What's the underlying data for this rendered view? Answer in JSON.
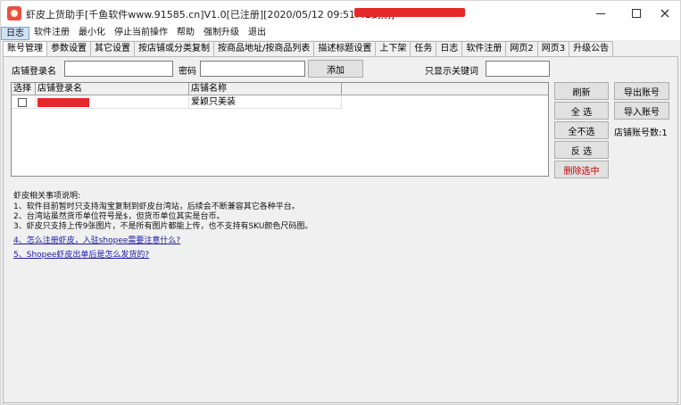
{
  "window": {
    "title": "虾皮上货助手[千鱼软件www.91585.cn]V1.0[已注册][2020/05/12 09:51:41到期]",
    "controls": {
      "minimize": "minimize",
      "maximize": "maximize",
      "close": "×"
    }
  },
  "menubar": {
    "items": [
      "日志",
      "软件注册",
      "最小化",
      "停止当前操作",
      "帮助",
      "强制升级",
      "退出"
    ]
  },
  "tabs": {
    "items": [
      "账号管理",
      "参数设置",
      "其它设置",
      "按店铺或分类复制",
      "按商品地址/按商品列表",
      "描述标题设置",
      "上下架",
      "任务",
      "日志",
      "软件注册",
      "网页2",
      "网页3",
      "升级公告"
    ],
    "active_index": 0
  },
  "account_form": {
    "store_login_label": "店铺登录名",
    "store_login_value": "",
    "password_label": "密码",
    "password_value": "",
    "add_button": "添加",
    "keyword_filter_label": "只显示关键词",
    "keyword_filter_value": ""
  },
  "grid": {
    "columns": [
      "选择",
      "店铺登录名",
      "店铺名称"
    ],
    "rows": [
      {
        "selected": false,
        "login_redacted": true,
        "store_name": "爱颖只美装"
      }
    ]
  },
  "side_buttons": {
    "refresh": "刷新",
    "export": "导出账号",
    "select_all": "全 选",
    "import": "导入账号",
    "deselect_all": "全不选",
    "store_count_label": "店铺账号数:1",
    "invert": "反 选",
    "delete_selected": "删除选中"
  },
  "notes": {
    "heading": "虾皮相关事项说明:",
    "lines": [
      "1、软件目前暂时只支持淘宝复制到虾皮台湾站，后续会不断兼容其它各种平台。",
      "2、台湾站虽然货币单位符号是$，但货币单位其实是台币。",
      "3、虾皮只支持上传9张图片，不是所有图片都能上传，也不支持有SKU颜色尺码图。"
    ],
    "links": [
      "4、怎么注册虾皮，入驻shopee需要注意什么?",
      "5、Shopee虾皮出单后是怎么发货的?"
    ]
  },
  "colors": {
    "redaction": "#e52828",
    "delete_text": "#c00000",
    "link": "#1a1aa6"
  }
}
